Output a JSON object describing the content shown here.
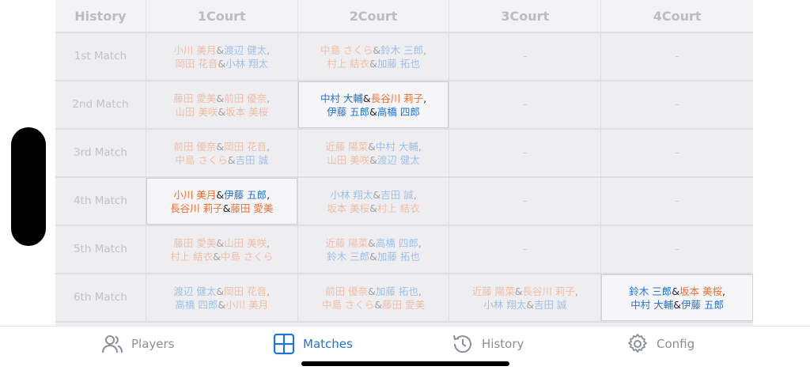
{
  "table": {
    "headers": [
      "History",
      "1Court",
      "2Court",
      "3Court",
      "4Court"
    ],
    "rows": [
      {
        "label": "1st Match",
        "courts": [
          {
            "a": [
              "小川 美月",
              "渡辺 健太"
            ],
            "b": [
              "岡田 花音",
              "小林 翔太"
            ],
            "active": false
          },
          {
            "a": [
              "中島 さくら",
              "鈴木 三郎"
            ],
            "b": [
              "村上 結衣",
              "加藤 拓也"
            ],
            "active": false
          },
          {
            "dash": "-"
          },
          {
            "dash": "-"
          }
        ]
      },
      {
        "label": "2nd Match",
        "courts": [
          {
            "a": [
              "藤田 愛美",
              "前田 優奈"
            ],
            "b": [
              "山田 美咲",
              "坂本 美桜"
            ],
            "active": false
          },
          {
            "a": [
              "中村 大輔",
              "長谷川 莉子"
            ],
            "b": [
              "伊藤 五郎",
              "高橋 四郎"
            ],
            "active": true
          },
          {
            "dash": "-"
          },
          {
            "dash": "-"
          }
        ]
      },
      {
        "label": "3rd Match",
        "courts": [
          {
            "a": [
              "前田 優奈",
              "岡田 花音"
            ],
            "b": [
              "中島 さくら",
              "吉田 誠"
            ],
            "active": false
          },
          {
            "a": [
              "近藤 陽菜",
              "中村 大輔"
            ],
            "b": [
              "山田 美咲",
              "渡辺 健太"
            ],
            "active": false
          },
          {
            "dash": "-"
          },
          {
            "dash": "-"
          }
        ]
      },
      {
        "label": "4th Match",
        "courts": [
          {
            "a": [
              "小川 美月",
              "伊藤 五郎"
            ],
            "b": [
              "長谷川 莉子",
              "藤田 愛美"
            ],
            "active": true
          },
          {
            "a": [
              "小林 翔太",
              "吉田 誠"
            ],
            "b": [
              "坂本 美桜",
              "村上 結衣"
            ],
            "active": false
          },
          {
            "dash": "-"
          },
          {
            "dash": "-"
          }
        ]
      },
      {
        "label": "5th Match",
        "courts": [
          {
            "a": [
              "藤田 愛美",
              "山田 美咲"
            ],
            "b": [
              "村上 結衣",
              "中島 さくら"
            ],
            "active": false
          },
          {
            "a": [
              "近藤 陽菜",
              "高橋 四郎"
            ],
            "b": [
              "鈴木 三郎",
              "加藤 拓也"
            ],
            "active": false
          },
          {
            "dash": "-"
          },
          {
            "dash": "-"
          }
        ]
      },
      {
        "label": "6th Match",
        "courts": [
          {
            "a": [
              "渡辺 健太",
              "岡田 花音"
            ],
            "b": [
              "高橋 四郎",
              "小川 美月"
            ],
            "active": false
          },
          {
            "a": [
              "前田 優奈",
              "加藤 拓也"
            ],
            "b": [
              "中島 さくら",
              "藤田 愛美"
            ],
            "active": false
          },
          {
            "a": [
              "近藤 陽菜",
              "長谷川 莉子"
            ],
            "b": [
              "小林 翔太",
              "吉田 誠"
            ],
            "active": false
          },
          {
            "a": [
              "鈴木 三郎",
              "坂本 美桜"
            ],
            "b": [
              "中村 大輔",
              "伊藤 五郎"
            ],
            "active": true
          }
        ]
      }
    ],
    "amp": "&",
    "separator": ","
  },
  "gender": {
    "男性": [
      "渡辺 健太",
      "小林 翔太",
      "鈴木 三郎",
      "加藤 拓也",
      "中村 大輔",
      "伊藤 五郎",
      "高橋 四郎",
      "吉田 誠"
    ],
    "女性": [
      "小川 美月",
      "岡田 花音",
      "中島 さくら",
      "村上 結衣",
      "藤田 愛美",
      "前田 優奈",
      "山田 美咲",
      "坂本 美桜",
      "長谷川 莉子",
      "近藤 陽菜"
    ]
  },
  "tabs": [
    {
      "label": "Players",
      "icon": "players-icon",
      "active": false
    },
    {
      "label": "Matches",
      "icon": "matches-icon",
      "active": true
    },
    {
      "label": "History",
      "icon": "history-icon",
      "active": false
    },
    {
      "label": "Config",
      "icon": "gear-icon",
      "active": false
    }
  ],
  "colors": {
    "male": "#1f74d6",
    "female": "#f07033",
    "accent": "#1f74d6"
  }
}
